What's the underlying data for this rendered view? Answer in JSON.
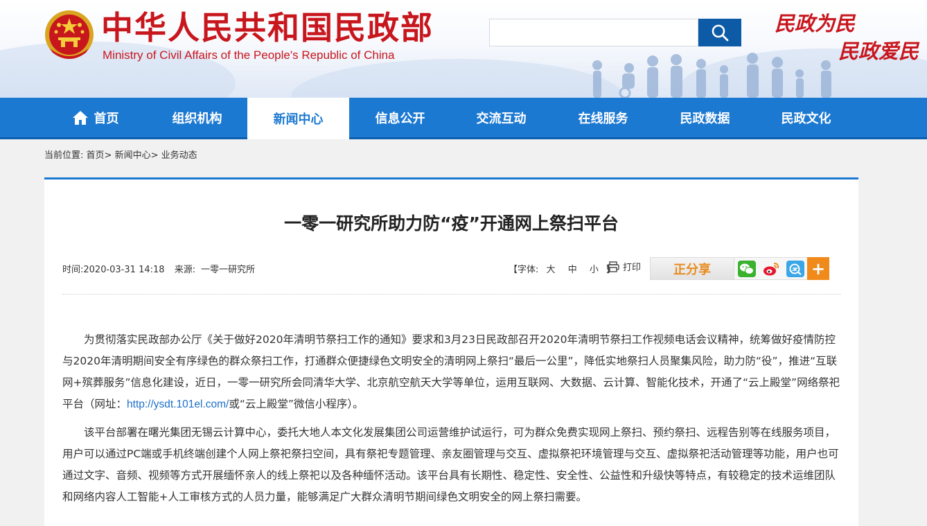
{
  "header": {
    "title_cn": "中华人民共和国民政部",
    "title_en": "Ministry of Civil Affairs of the People's Republic of China",
    "slogan_line1": "民政为民",
    "slogan_line2": "民政爱民",
    "search": {
      "value": "",
      "placeholder": ""
    },
    "brand_red": "#c8161d",
    "brand_blue": "#1c79d2"
  },
  "nav": {
    "items": [
      {
        "label": "首页",
        "icon": "home-icon"
      },
      {
        "label": "组织机构"
      },
      {
        "label": "新闻中心",
        "active": true
      },
      {
        "label": "信息公开"
      },
      {
        "label": "交流互动"
      },
      {
        "label": "在线服务"
      },
      {
        "label": "民政数据"
      },
      {
        "label": "民政文化"
      }
    ]
  },
  "breadcrumb": {
    "prefix": "当前位置:",
    "items": [
      "首页",
      "新闻中心",
      "业务动态"
    ],
    "separator": ">"
  },
  "article": {
    "title": "一零一研究所助力防“疫”开通网上祭扫平台",
    "time_label": "时间:",
    "time": "2020-03-31 14:18",
    "source_label": "来源:",
    "source": "一零一研究所",
    "font_label": "【字体:",
    "font_sizes": [
      "大",
      "中",
      "小"
    ],
    "font_close": "】",
    "print_label": "打印",
    "share_label": "正分享",
    "share_icons": [
      "wechat-icon",
      "weibo-icon",
      "qzone-icon"
    ],
    "share_more": "+",
    "p1_before_link": "为贯彻落实民政部办公厅《关于做好2020年清明节祭扫工作的通知》要求和3月23日民政部召开2020年清明节祭扫工作视频电话会议精神，统筹做好疫情防控与2020年清明期间安全有序绿色的群众祭扫工作，打通群众便捷绿色文明安全的清明网上祭扫“最后一公里”，降低实地祭扫人员聚集风险，助力防“役”，推进“互联网+殡葬服务”信息化建设，近日，一零一研究所会同清华大学、北京航空航天大学等单位，运用互联网、大数据、云计算、智能化技术，开通了“云上殿堂”网络祭祀平台（网址：",
    "p1_link": "http://ysdt.101el.com/",
    "p1_after_link": "或“云上殿堂”微信小程序）。",
    "p2": "该平台部署在曙光集团无锡云计算中心，委托大地人本文化发展集团公司运营维护试运行，可为群众免费实现网上祭扫、预约祭扫、远程告别等在线服务项目，用户可以通过PC端或手机终端创建个人网上祭祀祭扫空间，具有祭祀专题管理、亲友圈管理与交互、虚拟祭祀环境管理与交互、虚拟祭祀活动管理等功能，用户也可通过文字、音频、视频等方式开展缅怀亲人的线上祭祀以及各种缅怀活动。该平台具有长期性、稳定性、安全性、公益性和升级快等特点，有较稳定的技术运维团队和网络内容人工智能+人工审核方式的人员力量，能够满足广大群众清明节期间绿色文明安全的网上祭扫需要。"
  }
}
